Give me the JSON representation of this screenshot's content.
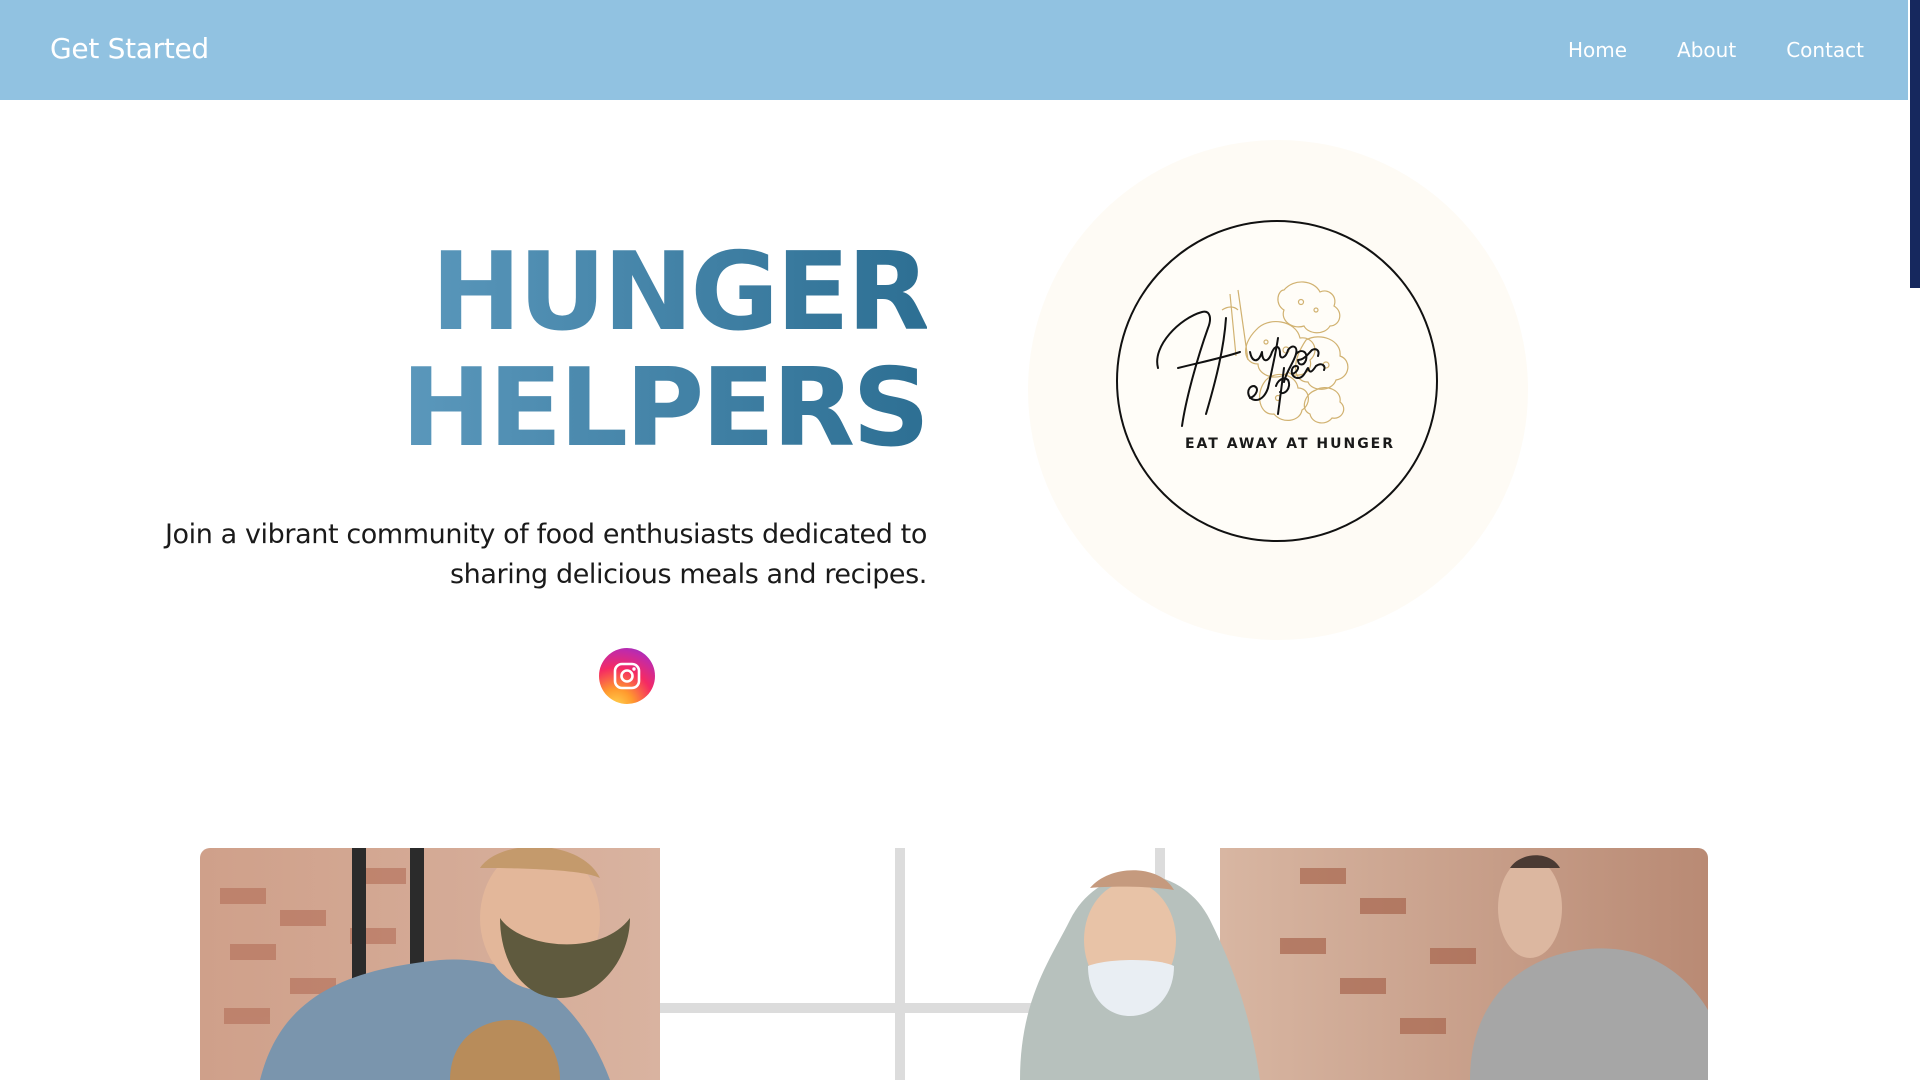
{
  "header": {
    "brand": "Get Started",
    "nav": [
      "Home",
      "About",
      "Contact"
    ]
  },
  "hero": {
    "title_line1": "HUNGER",
    "title_line2": "HELPERS",
    "subtitle_line1": "Join a vibrant community of food enthusiasts dedicated to",
    "subtitle_line2": "sharing delicious meals and recipes."
  },
  "logo": {
    "script_text": "Hunger Helpers",
    "tagline": "EAT AWAY AT HUNGER"
  },
  "icons": {
    "social": "instagram-icon",
    "logo_illustration": "vegetable-pile-icon"
  },
  "colors": {
    "header_bg": "#91c2e1",
    "title_gradient_start": "#5b98bc",
    "title_gradient_end": "#2d6f93",
    "halo": "#fefbf5",
    "scroll_thumb": "#16285e"
  }
}
